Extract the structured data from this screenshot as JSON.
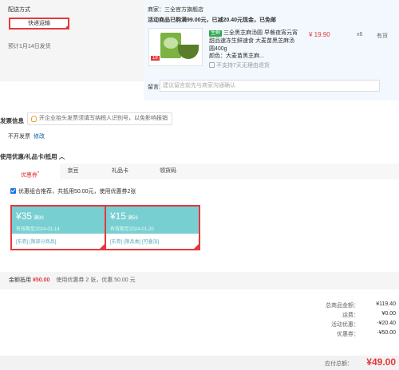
{
  "shipping": {
    "label": "配送方式",
    "button": "快递运输",
    "date": "预计1月14日发货"
  },
  "merchant": {
    "shop": "商家：三全官方旗舰店",
    "promo": "活动商品已购满99.00元，已减20.40元现金，已免邮",
    "product": {
      "tag": "生鲜",
      "title": "三全黑芝麻汤圆 早餐夜宵元宵甜品速冻生鲜速食 大麦苗黑芝麻汤圆400g",
      "attr": "颜色：大麦苗黑芝麻...",
      "return_note": "不支持7天无理由退货",
      "price": "¥ 19.90",
      "qty": "x6",
      "stock": "有货",
      "img_price": "19"
    },
    "remark_label": "留言:",
    "remark_placeholder": "建议留言前先与商家沟通确认"
  },
  "invoice": {
    "title": "发票信息",
    "tip": "开企业抬头发票须填写纳税人识别号，以免影响报销",
    "value": "不开发票",
    "modify": "修改"
  },
  "coupons": {
    "title": "使用优惠/礼品卡/抵用",
    "tabs": [
      {
        "label": "优惠券",
        "badge": "•"
      },
      {
        "label": "京豆"
      },
      {
        "label": "礼品卡"
      },
      {
        "label": "领货码"
      }
    ],
    "combo_text": "优惠组合推荐，共抵用50.00元，使用优惠券2张",
    "cards": [
      {
        "amount": "¥35",
        "limit": "满99",
        "valid": "有效期至2024-01-14",
        "scope": "[东券]  [限部分商品]"
      },
      {
        "amount": "¥15",
        "limit": "满59",
        "valid": "有效期至2024-01-20",
        "scope": "[东券]  [限品类]  [可叠加]"
      }
    ]
  },
  "summary": {
    "label": "金额抵用",
    "amount": "¥50.00",
    "note": "使用优惠券 2 张，优惠 50.00 元"
  },
  "totals": [
    {
      "key": "总商品金额：",
      "value": "¥119.40"
    },
    {
      "key": "运费：",
      "value": "¥0.00"
    },
    {
      "key": "活动优惠：",
      "value": "-¥20.40"
    },
    {
      "key": "优惠券：",
      "value": "-¥50.00"
    }
  ],
  "payment": {
    "label": "应付总额：",
    "amount": "¥49.00"
  },
  "colors": {
    "accent": "#e4393c",
    "coupon": "#78cfd2",
    "merchant_bg": "#f3f8fe"
  }
}
